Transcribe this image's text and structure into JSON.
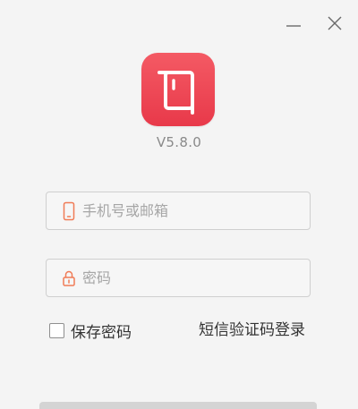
{
  "window": {
    "minimize_icon": "minimize-icon",
    "close_icon": "close-icon"
  },
  "app": {
    "logo_icon": "app-logo-icon",
    "logo_color": "#ee4452",
    "version": "V5.8.0"
  },
  "login": {
    "account_placeholder": "手机号或邮箱",
    "account_value": "",
    "account_icon": "phone-icon",
    "password_placeholder": "密码",
    "password_value": "",
    "password_icon": "lock-icon",
    "remember_label": "保存密码",
    "remember_checked": false,
    "sms_login_label": "短信验证码登录",
    "accent_color": "#f07b56"
  }
}
